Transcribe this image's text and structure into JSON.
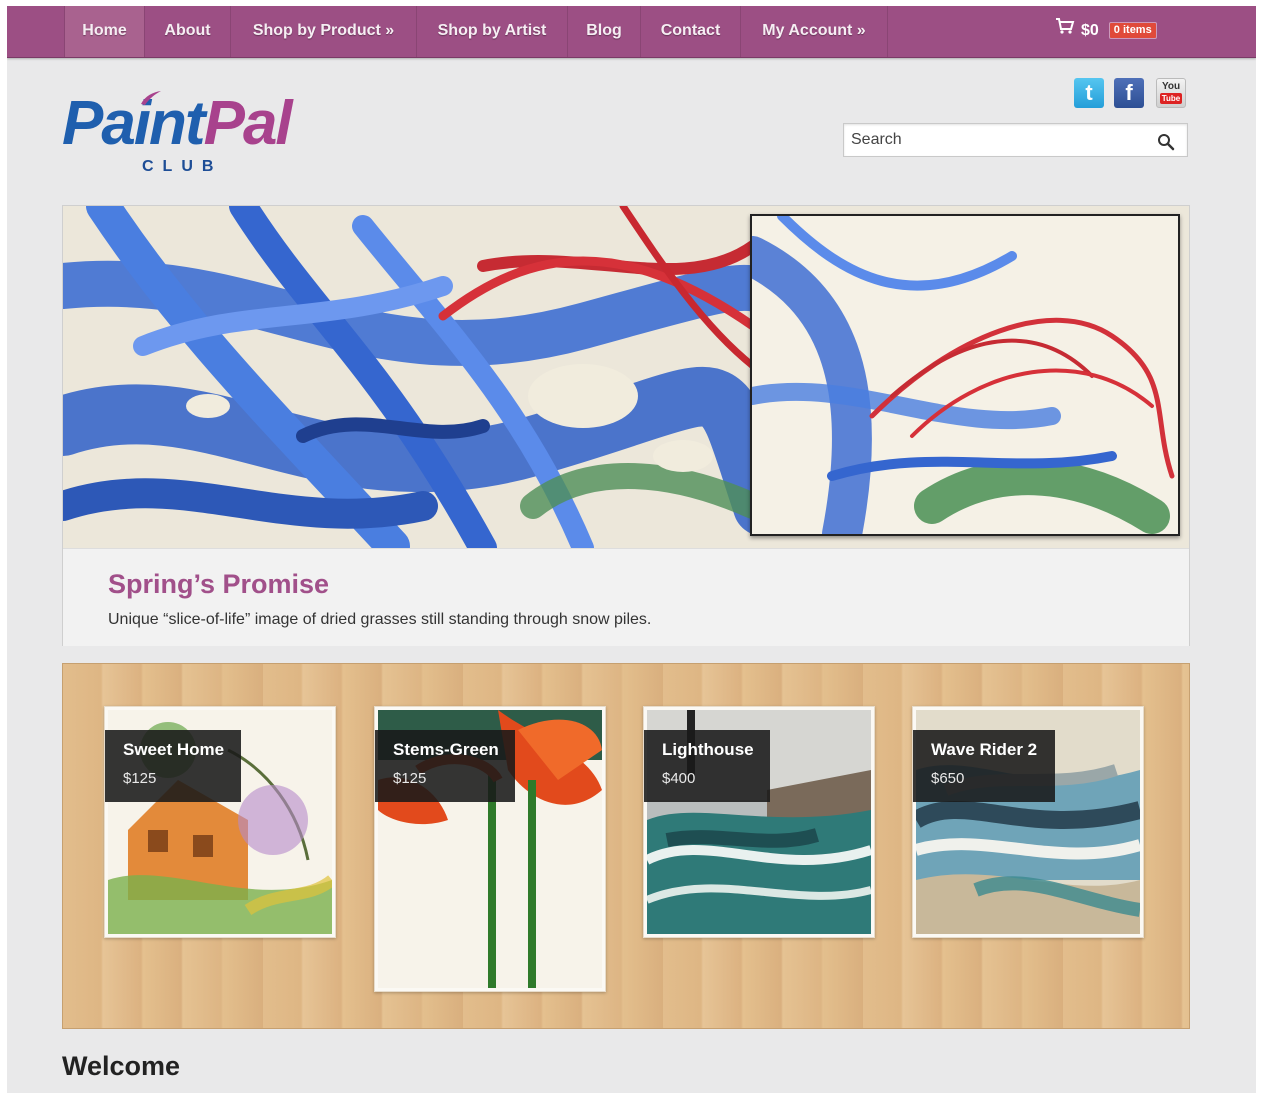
{
  "nav": {
    "items": [
      {
        "label": "Home"
      },
      {
        "label": "About"
      },
      {
        "label": "Shop by Product »"
      },
      {
        "label": "Shop by Artist"
      },
      {
        "label": "Blog"
      },
      {
        "label": "Contact"
      },
      {
        "label": "My Account »"
      }
    ],
    "active": "Home",
    "cart_total": "$0",
    "cart_items": "0 items",
    "cart_icon": "shopping-cart-icon"
  },
  "logo": {
    "paint": "Paint",
    "pal": "Pal",
    "club": "CLUB"
  },
  "social": {
    "twitter": "twitter-icon",
    "facebook": "facebook-icon",
    "youtube": "youtube-icon",
    "youtube_top": "You",
    "youtube_tube": "Tube"
  },
  "search": {
    "placeholder": "Search",
    "icon": "search-icon"
  },
  "hero": {
    "title": "Spring’s Promise",
    "description": "Unique “slice-of-life” image of dried grasses still standing through snow piles."
  },
  "products": [
    {
      "name": "Sweet Home",
      "price": "$125"
    },
    {
      "name": "Stems-Green",
      "price": "$125"
    },
    {
      "name": "Lighthouse",
      "price": "$400"
    },
    {
      "name": "Wave Rider 2",
      "price": "$650"
    }
  ],
  "welcome": "Welcome",
  "colors": {
    "nav": "#9c4f84",
    "accent": "#a1508a",
    "logo_blue": "#1f5fae",
    "cart_badge": "#e04a3a"
  }
}
